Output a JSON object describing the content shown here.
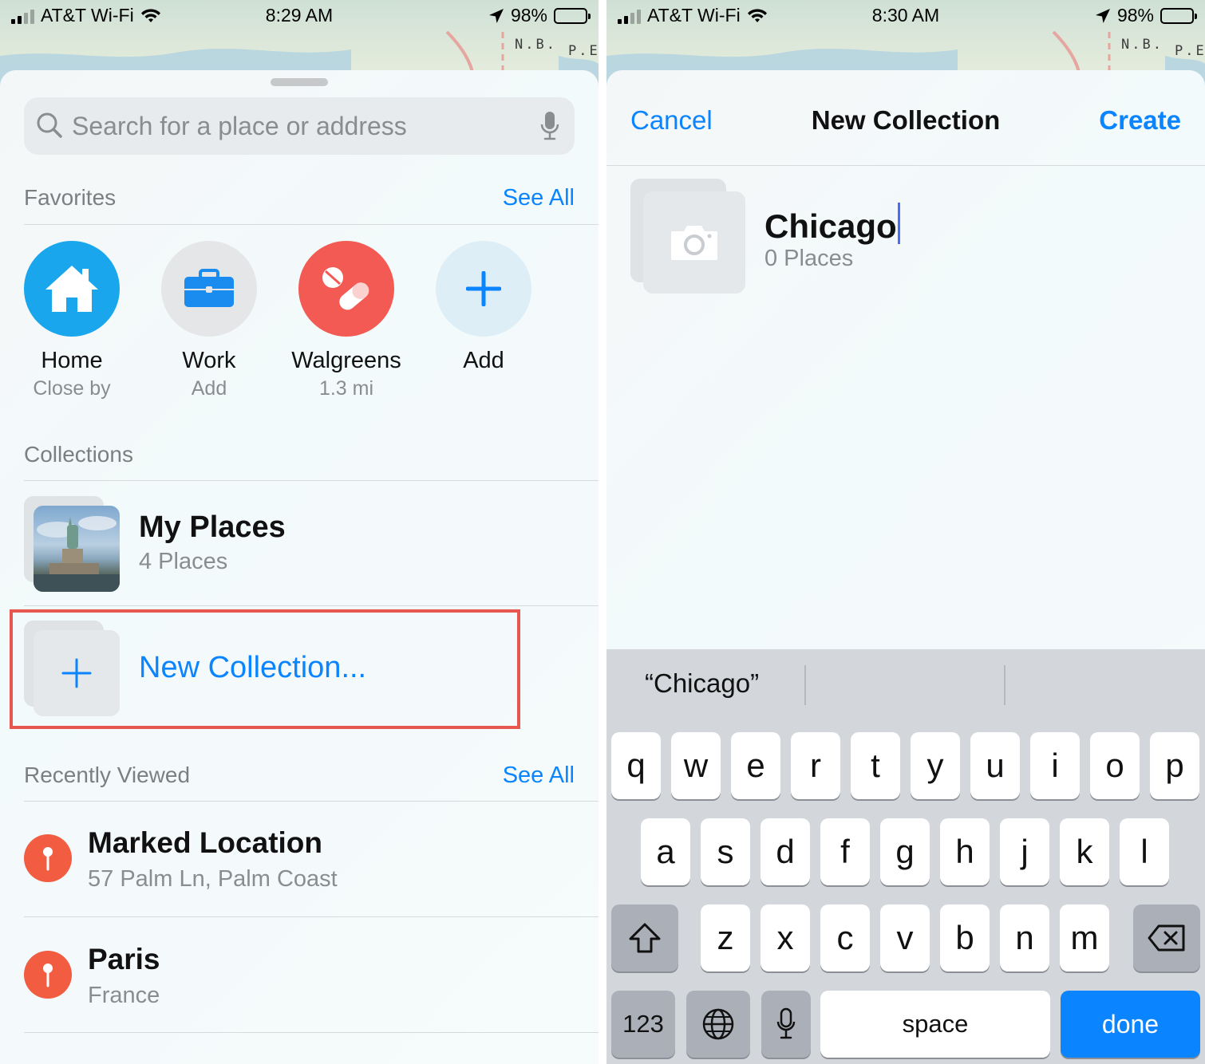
{
  "left": {
    "status": {
      "carrier": "AT&T Wi-Fi",
      "time": "8:29 AM",
      "battery": "98%"
    },
    "map_labels": {
      "nb": "N.B.",
      "pe": "P.E"
    },
    "search": {
      "placeholder": "Search for a place or address"
    },
    "favorites": {
      "heading": "Favorites",
      "see_all": "See All",
      "items": [
        {
          "name": "Home",
          "sub": "Close by",
          "icon": "house-icon",
          "color": "#1aa6ec"
        },
        {
          "name": "Work",
          "sub": "Add",
          "icon": "briefcase-icon",
          "color": "#e4e6e7"
        },
        {
          "name": "Walgreens",
          "sub": "1.3 mi",
          "icon": "pill-icon",
          "color": "#f35a54"
        },
        {
          "name": "Add",
          "sub": "",
          "icon": "plus-icon",
          "color": "#deeef6"
        }
      ]
    },
    "collections": {
      "heading": "Collections",
      "items": [
        {
          "title": "My Places",
          "sub": "4 Places"
        }
      ],
      "new_collection": "New Collection..."
    },
    "recent": {
      "heading": "Recently Viewed",
      "see_all": "See All",
      "items": [
        {
          "title": "Marked Location",
          "sub": "57 Palm Ln, Palm Coast"
        },
        {
          "title": "Paris",
          "sub": "France"
        }
      ]
    }
  },
  "right": {
    "status": {
      "carrier": "AT&T Wi-Fi",
      "time": "8:30 AM",
      "battery": "98%"
    },
    "map_labels": {
      "nb": "N.B.",
      "pe": "P.E"
    },
    "nav": {
      "cancel": "Cancel",
      "title": "New Collection",
      "create": "Create"
    },
    "collection": {
      "name": "Chicago",
      "count": "0 Places"
    },
    "keyboard": {
      "prediction": "“Chicago”",
      "row1": [
        "q",
        "w",
        "e",
        "r",
        "t",
        "y",
        "u",
        "i",
        "o",
        "p"
      ],
      "row2": [
        "a",
        "s",
        "d",
        "f",
        "g",
        "h",
        "j",
        "k",
        "l"
      ],
      "row3": [
        "z",
        "x",
        "c",
        "v",
        "b",
        "n",
        "m"
      ],
      "numbers": "123",
      "space": "space",
      "done": "done"
    }
  },
  "colors": {
    "accent": "#0a84ff",
    "highlight": "#e8574f",
    "pin": "#f25c40"
  }
}
